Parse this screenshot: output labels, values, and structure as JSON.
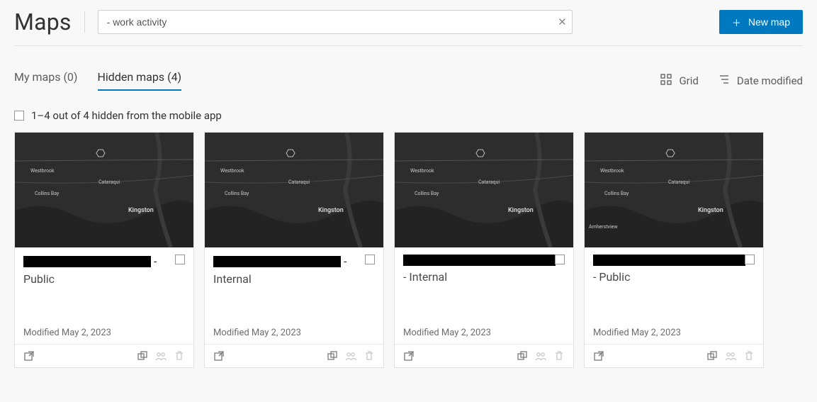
{
  "page": {
    "title": "Maps"
  },
  "search": {
    "value": "- work activity"
  },
  "actions": {
    "new_map_label": "New map"
  },
  "tabs": {
    "my_maps": "My maps (0)",
    "hidden_maps": "Hidden maps (4)"
  },
  "view": {
    "grid_label": "Grid",
    "sort_label": "Date modified"
  },
  "selection": {
    "summary": "1–4 out of 4 hidden from the mobile app"
  },
  "cards": [
    {
      "trailing_dash": "-",
      "subtitle": "Public",
      "modified": "Modified May 2, 2023",
      "redact_wide": false,
      "leading_dash": ""
    },
    {
      "trailing_dash": "-",
      "subtitle": "Internal",
      "modified": "Modified May 2, 2023",
      "redact_wide": false,
      "leading_dash": ""
    },
    {
      "trailing_dash": "",
      "subtitle": "- Internal",
      "modified": "Modified May 2, 2023",
      "redact_wide": true,
      "leading_dash": ""
    },
    {
      "trailing_dash": "",
      "subtitle": "- Public",
      "modified": "Modified May 2, 2023",
      "redact_wide": true,
      "leading_dash": ""
    }
  ],
  "map_labels": {
    "westbrook": "Westbrook",
    "cataraqui": "Cataraqui",
    "collins": "Collins Bay",
    "kingston": "Kingston",
    "amherst": "Amherstview"
  }
}
